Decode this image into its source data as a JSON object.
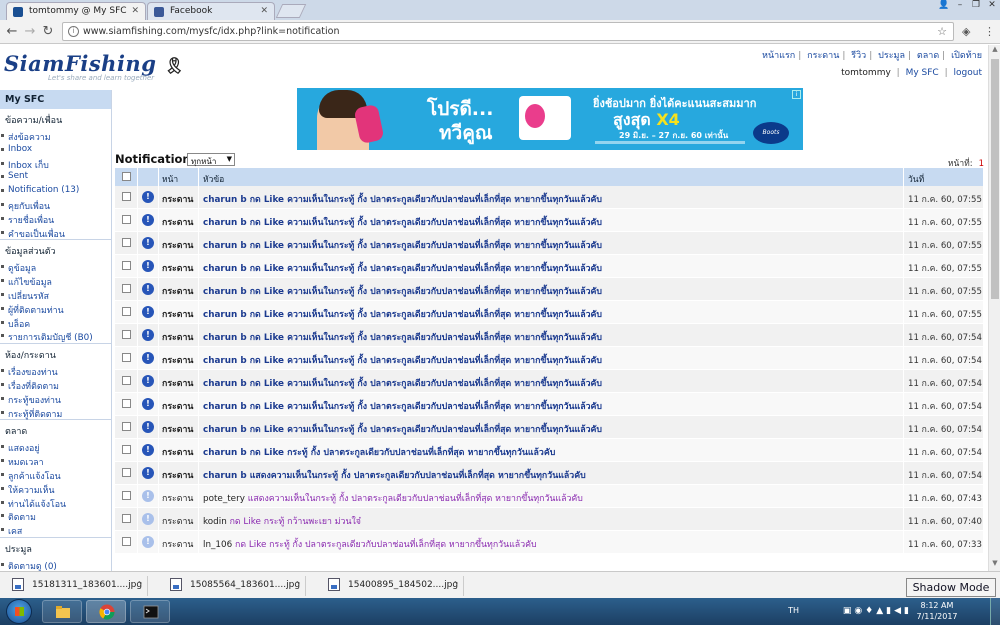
{
  "browser": {
    "tabs": [
      {
        "label": "tomtommy @ My SFC",
        "active": true
      },
      {
        "label": "Facebook",
        "active": false
      }
    ],
    "url": "www.siamfishing.com/mysfc/idx.php?link=notification"
  },
  "site": {
    "logo": "SiamFishing",
    "tagline": "Let's share and learn together",
    "topnav": [
      "หน้าแรก",
      "กระดาน",
      "รีวิว",
      "ประมูล",
      "ตลาด",
      "เปิดท้าย"
    ],
    "username": "tomtommy",
    "mysfc_link": "My SFC",
    "logout_link": "logout"
  },
  "banner": {
    "line1": "โปรดี...",
    "line2": "ทวีคูณ",
    "line3": "ยิ่งช้อปมาก ยิ่งได้คะแนนสะสมมาก",
    "line4a": "สูงสุด",
    "line4b": "X4",
    "line5": "29 มิ.ย. – 27 ก.ย. 60 เท่านั้น",
    "brand": "Boots",
    "colors": {
      "bg": "#27a8de"
    }
  },
  "sidebar": {
    "title": "My SFC",
    "sections": [
      {
        "title": "ข้อความ/เพื่อน",
        "items": [
          "ส่งข้อความ",
          "Inbox",
          "Inbox เก็บ",
          "Sent",
          "Notification (13)",
          "คุยกับเพื่อน",
          "รายชื่อเพื่อน",
          "คำขอเป็นเพื่อน"
        ]
      },
      {
        "title": "ข้อมูลส่วนตัว",
        "items": [
          "ดูข้อมูล",
          "แก้ไขข้อมูล",
          "เปลี่ยนรหัส",
          "ผู้ที่ติดตามท่าน",
          "บล็อค",
          "รายการเติมบัญชี (B0)"
        ]
      },
      {
        "title": "ห้อง/กระดาน",
        "items": [
          "เรื่องของท่าน",
          "เรื่องที่ติดตาม",
          "กระทู้ของท่าน",
          "กระทู้ที่ติดตาม"
        ]
      },
      {
        "title": "ตลาด",
        "items": [
          "แสดงอยู่",
          "หมดเวลา",
          "ลูกค้าแจ้งโอน",
          "ให้ความเห็น",
          "ท่านได้แจ้งโอน",
          "ติดตาม",
          "เคส"
        ]
      },
      {
        "title": "ประมูล",
        "items": [
          "ติดตามดู (0)"
        ]
      }
    ]
  },
  "notification": {
    "title": "Notification",
    "filter": "ทุกหน้า",
    "page_label": "หน้าที่:",
    "page_number": "1",
    "columns": {
      "page": "หน้า",
      "subject": "หัวข้อ",
      "date": "วันที่"
    },
    "rows": [
      {
        "cat": "กระดาน",
        "who": "charun b",
        "text": "กด Like ความเห็นในกระทู้ กั้ง ปลาตระกูลเดียวกับปลาช่อนที่เล็กที่สุด หายากขึ้นทุกวันแล้วคับ",
        "date": "11 ก.ค. 60, 07:55",
        "read": false
      },
      {
        "cat": "กระดาน",
        "who": "charun b",
        "text": "กด Like ความเห็นในกระทู้ กั้ง ปลาตระกูลเดียวกับปลาช่อนที่เล็กที่สุด หายากขึ้นทุกวันแล้วคับ",
        "date": "11 ก.ค. 60, 07:55",
        "read": false
      },
      {
        "cat": "กระดาน",
        "who": "charun b",
        "text": "กด Like ความเห็นในกระทู้ กั้ง ปลาตระกูลเดียวกับปลาช่อนที่เล็กที่สุด หายากขึ้นทุกวันแล้วคับ",
        "date": "11 ก.ค. 60, 07:55",
        "read": false
      },
      {
        "cat": "กระดาน",
        "who": "charun b",
        "text": "กด Like ความเห็นในกระทู้ กั้ง ปลาตระกูลเดียวกับปลาช่อนที่เล็กที่สุด หายากขึ้นทุกวันแล้วคับ",
        "date": "11 ก.ค. 60, 07:55",
        "read": false
      },
      {
        "cat": "กระดาน",
        "who": "charun b",
        "text": "กด Like ความเห็นในกระทู้ กั้ง ปลาตระกูลเดียวกับปลาช่อนที่เล็กที่สุด หายากขึ้นทุกวันแล้วคับ",
        "date": "11 ก.ค. 60, 07:55",
        "read": false
      },
      {
        "cat": "กระดาน",
        "who": "charun b",
        "text": "กด Like ความเห็นในกระทู้ กั้ง ปลาตระกูลเดียวกับปลาช่อนที่เล็กที่สุด หายากขึ้นทุกวันแล้วคับ",
        "date": "11 ก.ค. 60, 07:55",
        "read": false
      },
      {
        "cat": "กระดาน",
        "who": "charun b",
        "text": "กด Like ความเห็นในกระทู้ กั้ง ปลาตระกูลเดียวกับปลาช่อนที่เล็กที่สุด หายากขึ้นทุกวันแล้วคับ",
        "date": "11 ก.ค. 60, 07:54",
        "read": false
      },
      {
        "cat": "กระดาน",
        "who": "charun b",
        "text": "กด Like ความเห็นในกระทู้ กั้ง ปลาตระกูลเดียวกับปลาช่อนที่เล็กที่สุด หายากขึ้นทุกวันแล้วคับ",
        "date": "11 ก.ค. 60, 07:54",
        "read": false
      },
      {
        "cat": "กระดาน",
        "who": "charun b",
        "text": "กด Like ความเห็นในกระทู้ กั้ง ปลาตระกูลเดียวกับปลาช่อนที่เล็กที่สุด หายากขึ้นทุกวันแล้วคับ",
        "date": "11 ก.ค. 60, 07:54",
        "read": false
      },
      {
        "cat": "กระดาน",
        "who": "charun b",
        "text": "กด Like ความเห็นในกระทู้ กั้ง ปลาตระกูลเดียวกับปลาช่อนที่เล็กที่สุด หายากขึ้นทุกวันแล้วคับ",
        "date": "11 ก.ค. 60, 07:54",
        "read": false
      },
      {
        "cat": "กระดาน",
        "who": "charun b",
        "text": "กด Like ความเห็นในกระทู้ กั้ง ปลาตระกูลเดียวกับปลาช่อนที่เล็กที่สุด หายากขึ้นทุกวันแล้วคับ",
        "date": "11 ก.ค. 60, 07:54",
        "read": false
      },
      {
        "cat": "กระดาน",
        "who": "charun b",
        "text": "กด Like กระทู้ กั้ง ปลาตระกูลเดียวกับปลาช่อนที่เล็กที่สุด หายากขึ้นทุกวันแล้วคับ",
        "date": "11 ก.ค. 60, 07:54",
        "read": false
      },
      {
        "cat": "กระดาน",
        "who": "charun b",
        "text": "แสดงความเห็นในกระทู้ กั้ง ปลาตระกูลเดียวกับปลาช่อนที่เล็กที่สุด หายากขึ้นทุกวันแล้วคับ",
        "date": "11 ก.ค. 60, 07:54",
        "read": false
      },
      {
        "cat": "กระดาน",
        "who": "pote_tery",
        "text": "แสดงความเห็นในกระทู้ กั้ง ปลาตระกูลเดียวกับปลาช่อนที่เล็กที่สุด หายากขึ้นทุกวันแล้วคับ",
        "date": "11 ก.ค. 60, 07:43",
        "read": true
      },
      {
        "cat": "กระดาน",
        "who": "kodin",
        "text": "กด Like กระทู้ กว้านพะเยา ม่วนใจ๋",
        "date": "11 ก.ค. 60, 07:40",
        "read": true
      },
      {
        "cat": "กระดาน",
        "who": "ln_106",
        "text": "กด Like กระทู้ กั้ง ปลาตระกูลเดียวกับปลาช่อนที่เล็กที่สุด หายากขึ้นทุกวันแล้วคับ",
        "date": "11 ก.ค. 60, 07:33",
        "read": true
      }
    ]
  },
  "downloads": [
    {
      "name": "15181311_183601....jpg"
    },
    {
      "name": "15085564_183601....jpg"
    },
    {
      "name": "15400895_184502....jpg"
    }
  ],
  "overlay": {
    "shadow_mode": "Shadow Mode"
  },
  "taskbar": {
    "lang": "TH",
    "time": "8:12 AM",
    "date": "7/11/2017"
  }
}
